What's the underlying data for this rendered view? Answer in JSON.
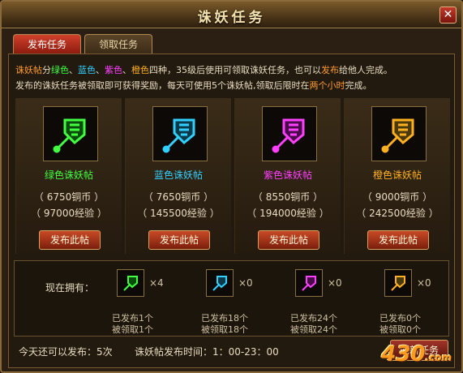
{
  "window": {
    "title": "诛妖任务",
    "close_label": "✕"
  },
  "tabs": [
    {
      "label": "发布任务",
      "active": true
    },
    {
      "label": "领取任务",
      "active": false
    }
  ],
  "description": {
    "line1_a": "诛妖帖",
    "line1_b": "分",
    "green": "绿色",
    "sep1": "、",
    "blue": "蓝色",
    "sep2": "、",
    "purple": "紫色",
    "sep3": "、",
    "orange": "橙色",
    "line1_c": "四种，35级后使用可领取诛妖任务，也可以",
    "publish_word": "发布",
    "line1_d": "给他人完成。",
    "line2_a": "发布的诛妖任务被领取即可获得奖励，每天可使用5个诛妖帖,领取后限时在",
    "line2_hl": "两个小时",
    "line2_b": "完成。"
  },
  "cards": [
    {
      "name": "绿色诛妖帖",
      "color": "#42ff42",
      "icon": "green-token-icon",
      "copper": "（   6750铜币   ）",
      "exp": "（  97000经验   ）",
      "button": "发布此帖"
    },
    {
      "name": "蓝色诛妖帖",
      "color": "#32d0ff",
      "icon": "blue-token-icon",
      "copper": "（   7650铜币   ）",
      "exp": "（  145500经验   ）",
      "button": "发布此帖"
    },
    {
      "name": "紫色诛妖帖",
      "color": "#ff40ff",
      "icon": "purple-token-icon",
      "copper": "（   8550铜币   ）",
      "exp": "（  194000经验   ）",
      "button": "发布此帖"
    },
    {
      "name": "橙色诛妖帖",
      "color": "#ffb020",
      "icon": "orange-token-icon",
      "copper": "（   9000铜币   ）",
      "exp": "（  242500经验   ）",
      "button": "发布此帖"
    }
  ],
  "owned": {
    "label": "现在拥有：",
    "items": [
      {
        "count": "×4",
        "published": "已发布1个",
        "taken": "被领取1个",
        "color": "#42ff42"
      },
      {
        "count": "×0",
        "published": "已发布18个",
        "taken": "被领取18个",
        "color": "#32d0ff"
      },
      {
        "count": "×0",
        "published": "已发布24个",
        "taken": "被领取24个",
        "color": "#ff40ff"
      },
      {
        "count": "×0",
        "published": "已发布0个",
        "taken": "被领取0个",
        "color": "#ffb020"
      }
    ]
  },
  "footer": {
    "remaining": "今天还可以发布：5次",
    "time": "诛妖帖发布时间：1：00-23：00",
    "refresh_button": "刷新任务"
  },
  "logo": {
    "main": "430",
    "sub": ".com"
  }
}
